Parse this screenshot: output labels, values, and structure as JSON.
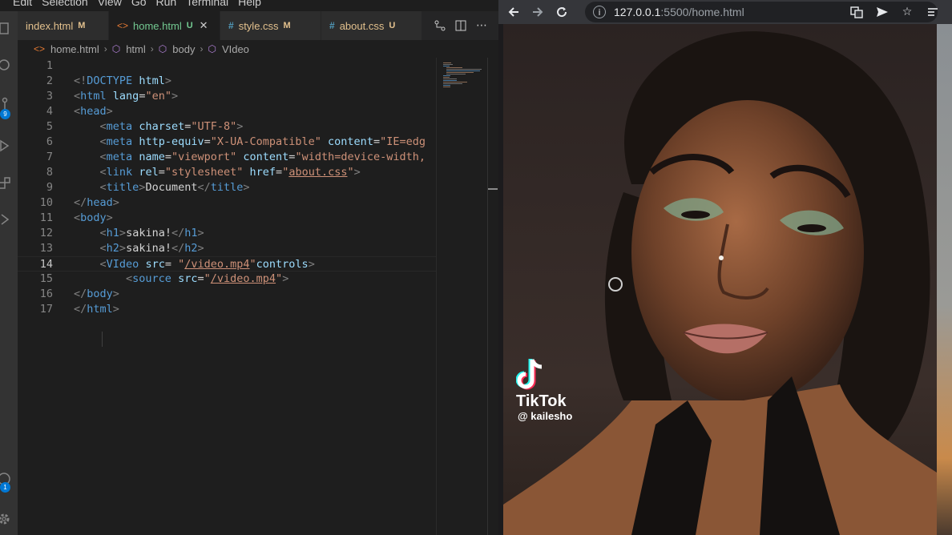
{
  "menubar": {
    "items": [
      "Edit",
      "Selection",
      "View",
      "Go",
      "Run",
      "Terminal",
      "Help"
    ]
  },
  "activity": {
    "scm_badge": "9",
    "accounts_badge": "1"
  },
  "tabs": [
    {
      "label": "index.html",
      "status": "M",
      "type": "html"
    },
    {
      "label": "home.html",
      "status": "U",
      "type": "html",
      "active": true
    },
    {
      "label": "style.css",
      "status": "M",
      "type": "css"
    },
    {
      "label": "about.css",
      "status": "U",
      "type": "css"
    }
  ],
  "breadcrumb": [
    "home.html",
    "html",
    "body",
    "VIdeo"
  ],
  "editor": {
    "current_line": 14,
    "line_numbers": [
      "1",
      "2",
      "3",
      "4",
      "5",
      "6",
      "7",
      "8",
      "9",
      "10",
      "11",
      "12",
      "13",
      "14",
      "15",
      "16",
      "17"
    ],
    "lines": [
      {
        "parts": []
      },
      {
        "parts": [
          [
            "br",
            "<!"
          ],
          [
            "tag",
            "DOCTYPE"
          ],
          [
            "txt",
            " "
          ],
          [
            "attr",
            "html"
          ],
          [
            "br",
            ">"
          ]
        ]
      },
      {
        "parts": [
          [
            "br",
            "<"
          ],
          [
            "tag",
            "html"
          ],
          [
            "txt",
            " "
          ],
          [
            "attr",
            "lang"
          ],
          [
            "txt",
            "="
          ],
          [
            "str",
            "\"en\""
          ],
          [
            "br",
            ">"
          ]
        ]
      },
      {
        "parts": [
          [
            "br",
            "<"
          ],
          [
            "tag",
            "head"
          ],
          [
            "br",
            ">"
          ]
        ]
      },
      {
        "parts": [
          [
            "txt",
            "    "
          ],
          [
            "br",
            "<"
          ],
          [
            "tag",
            "meta"
          ],
          [
            "txt",
            " "
          ],
          [
            "attr",
            "charset"
          ],
          [
            "txt",
            "="
          ],
          [
            "str",
            "\"UTF-8\""
          ],
          [
            "br",
            ">"
          ]
        ]
      },
      {
        "parts": [
          [
            "txt",
            "    "
          ],
          [
            "br",
            "<"
          ],
          [
            "tag",
            "meta"
          ],
          [
            "txt",
            " "
          ],
          [
            "attr",
            "http-equiv"
          ],
          [
            "txt",
            "="
          ],
          [
            "str",
            "\"X-UA-Compatible\""
          ],
          [
            "txt",
            " "
          ],
          [
            "attr",
            "content"
          ],
          [
            "txt",
            "="
          ],
          [
            "str",
            "\"IE=edg"
          ]
        ]
      },
      {
        "parts": [
          [
            "txt",
            "    "
          ],
          [
            "br",
            "<"
          ],
          [
            "tag",
            "meta"
          ],
          [
            "txt",
            " "
          ],
          [
            "attr",
            "name"
          ],
          [
            "txt",
            "="
          ],
          [
            "str",
            "\"viewport\""
          ],
          [
            "txt",
            " "
          ],
          [
            "attr",
            "content"
          ],
          [
            "txt",
            "="
          ],
          [
            "str",
            "\"width=device-width,"
          ]
        ]
      },
      {
        "parts": [
          [
            "txt",
            "    "
          ],
          [
            "br",
            "<"
          ],
          [
            "tag",
            "link"
          ],
          [
            "txt",
            " "
          ],
          [
            "attr",
            "rel"
          ],
          [
            "txt",
            "="
          ],
          [
            "str",
            "\"stylesheet\""
          ],
          [
            "txt",
            " "
          ],
          [
            "attr",
            "href"
          ],
          [
            "txt",
            "="
          ],
          [
            "str",
            "\""
          ],
          [
            "link",
            "about.css"
          ],
          [
            "str",
            "\""
          ],
          [
            "br",
            ">"
          ]
        ]
      },
      {
        "parts": [
          [
            "txt",
            "    "
          ],
          [
            "br",
            "<"
          ],
          [
            "tag",
            "title"
          ],
          [
            "br",
            ">"
          ],
          [
            "txt",
            "Document"
          ],
          [
            "br",
            "</"
          ],
          [
            "tag",
            "title"
          ],
          [
            "br",
            ">"
          ]
        ]
      },
      {
        "parts": [
          [
            "br",
            "</"
          ],
          [
            "tag",
            "head"
          ],
          [
            "br",
            ">"
          ]
        ]
      },
      {
        "parts": [
          [
            "br",
            "<"
          ],
          [
            "tag",
            "body"
          ],
          [
            "br",
            ">"
          ]
        ]
      },
      {
        "parts": [
          [
            "txt",
            "    "
          ],
          [
            "br",
            "<"
          ],
          [
            "tag",
            "h1"
          ],
          [
            "br",
            ">"
          ],
          [
            "txt",
            "sakina!"
          ],
          [
            "br",
            "</"
          ],
          [
            "tag",
            "h1"
          ],
          [
            "br",
            ">"
          ]
        ]
      },
      {
        "parts": [
          [
            "txt",
            "    "
          ],
          [
            "br",
            "<"
          ],
          [
            "tag",
            "h2"
          ],
          [
            "br",
            ">"
          ],
          [
            "txt",
            "sakina!"
          ],
          [
            "br",
            "</"
          ],
          [
            "tag",
            "h2"
          ],
          [
            "br",
            ">"
          ]
        ]
      },
      {
        "parts": [
          [
            "txt",
            "    "
          ],
          [
            "br",
            "<"
          ],
          [
            "tag",
            "VIdeo"
          ],
          [
            "txt",
            " "
          ],
          [
            "attr",
            "src"
          ],
          [
            "txt",
            "= "
          ],
          [
            "str",
            "\""
          ],
          [
            "link",
            "/video.mp4"
          ],
          [
            "str",
            "\""
          ],
          [
            "attr",
            "controls"
          ],
          [
            "br",
            ">"
          ]
        ]
      },
      {
        "parts": [
          [
            "txt",
            "        "
          ],
          [
            "br",
            "<"
          ],
          [
            "tag",
            "source"
          ],
          [
            "txt",
            " "
          ],
          [
            "attr",
            "src"
          ],
          [
            "txt",
            "="
          ],
          [
            "str",
            "\""
          ],
          [
            "link",
            "/video.mp4"
          ],
          [
            "str",
            "\""
          ],
          [
            "br",
            ">"
          ]
        ]
      },
      {
        "parts": [
          [
            "br",
            "</"
          ],
          [
            "tag",
            "body"
          ],
          [
            "br",
            ">"
          ]
        ]
      },
      {
        "parts": [
          [
            "br",
            "</"
          ],
          [
            "tag",
            "html"
          ],
          [
            "br",
            ">"
          ]
        ]
      }
    ]
  },
  "browser": {
    "url_host": "127.0.0.1",
    "url_path": ":5500/home.html"
  },
  "video": {
    "watermark_brand": "TikTok",
    "watermark_user": "@ kailesho"
  },
  "colors": {
    "tag": "#569cd6",
    "attr": "#9cdcfe",
    "string": "#ce9178",
    "bracket": "#808080",
    "text": "#d4d4d4",
    "modified": "#e2c08d",
    "untracked": "#73c991"
  }
}
